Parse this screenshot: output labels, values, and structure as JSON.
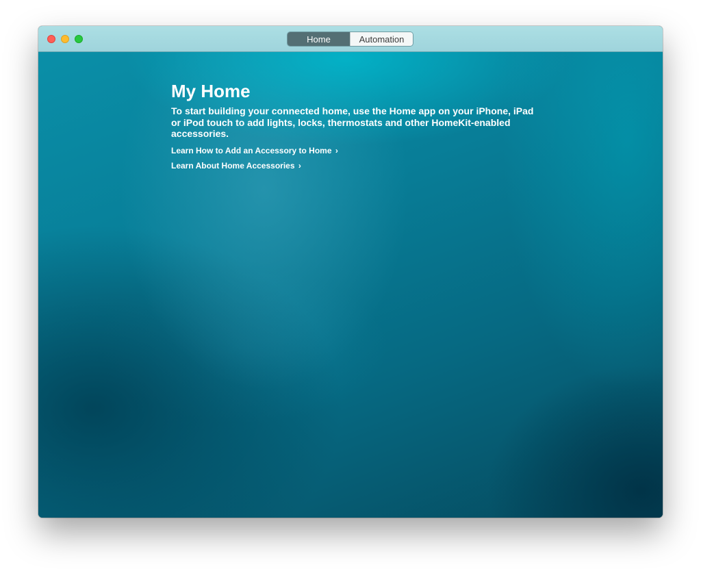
{
  "window": {
    "tabs": [
      {
        "label": "Home",
        "selected": true
      },
      {
        "label": "Automation",
        "selected": false
      }
    ]
  },
  "main": {
    "title": "My Home",
    "description": "To start building your connected home, use the Home app on your iPhone, iPad or iPod touch to add lights, locks, thermostats and other HomeKit-enabled accessories.",
    "links": [
      {
        "label": "Learn How to Add an Accessory to Home",
        "icon": "chevron-right-icon"
      },
      {
        "label": "Learn About Home Accessories",
        "icon": "chevron-right-icon"
      }
    ],
    "chevron": "›"
  },
  "colors": {
    "close": "#fe5f57",
    "minimize": "#febc2e",
    "zoom": "#28c840",
    "selected_tab": "#546f74",
    "background": "#0b6f86"
  }
}
